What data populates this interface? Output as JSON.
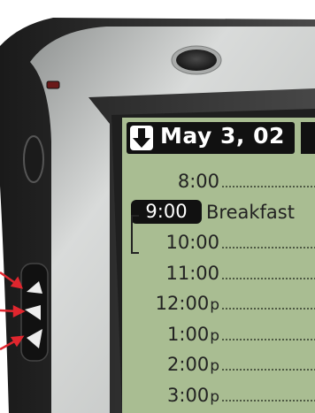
{
  "screen": {
    "date_label": "May 3, 02",
    "selected_index": 1,
    "rows": [
      {
        "time": "8:00",
        "suffix": "",
        "event": ""
      },
      {
        "time": "9:00",
        "suffix": "",
        "event": "Breakfast"
      },
      {
        "time": "10:00",
        "suffix": "",
        "event": ""
      },
      {
        "time": "11:00",
        "suffix": "",
        "event": ""
      },
      {
        "time": "12:00",
        "suffix": "p",
        "event": ""
      },
      {
        "time": "1:00",
        "suffix": "p",
        "event": ""
      },
      {
        "time": "2:00",
        "suffix": "p",
        "event": ""
      },
      {
        "time": "3:00",
        "suffix": "p",
        "event": ""
      }
    ]
  },
  "colors": {
    "lcd": "#a9bd92",
    "bezel_dark": "#2d2d2d",
    "casing": "#c7c9c8",
    "annotation_arrows": "#e0262e"
  },
  "icons": [
    "down-arrow-icon",
    "stylus-button-icon",
    "speaker-grille-icon",
    "jog-up-icon",
    "jog-press-icon",
    "jog-down-icon"
  ]
}
